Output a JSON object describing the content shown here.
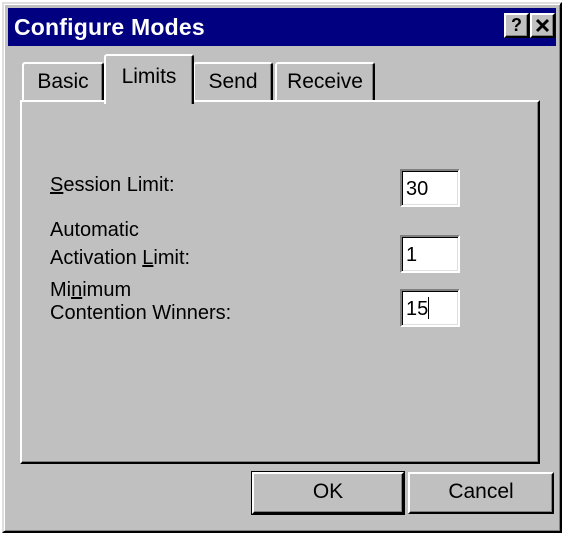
{
  "window": {
    "title": "Configure Modes",
    "help_label": "?",
    "close_icon": "close-icon"
  },
  "tabs": [
    {
      "label": "Basic",
      "selected": false
    },
    {
      "label": "Limits",
      "selected": true
    },
    {
      "label": "Send",
      "selected": false
    },
    {
      "label": "Receive",
      "selected": false
    }
  ],
  "fields": {
    "session_limit": {
      "label_mnemonic": "S",
      "label_rest": "ession Limit:",
      "value": "30"
    },
    "automatic_activation_limit": {
      "label_line1": "Automatic",
      "label_line2_pre": "Activation ",
      "label_mnemonic": "L",
      "label_line2_post": "imit:",
      "value": "1"
    },
    "minimum_contention_winners": {
      "label_line1_pre": "Mi",
      "label_mnemonic": "n",
      "label_line1_post": "imum",
      "label_line2": "Contention Winners:",
      "value": "15"
    }
  },
  "buttons": {
    "ok_label": "OK",
    "cancel_label": "Cancel"
  },
  "colors": {
    "face": "#c0c0c0",
    "titlebar": "#000080",
    "title_text": "#ffffff",
    "input_bg": "#ffffff"
  }
}
